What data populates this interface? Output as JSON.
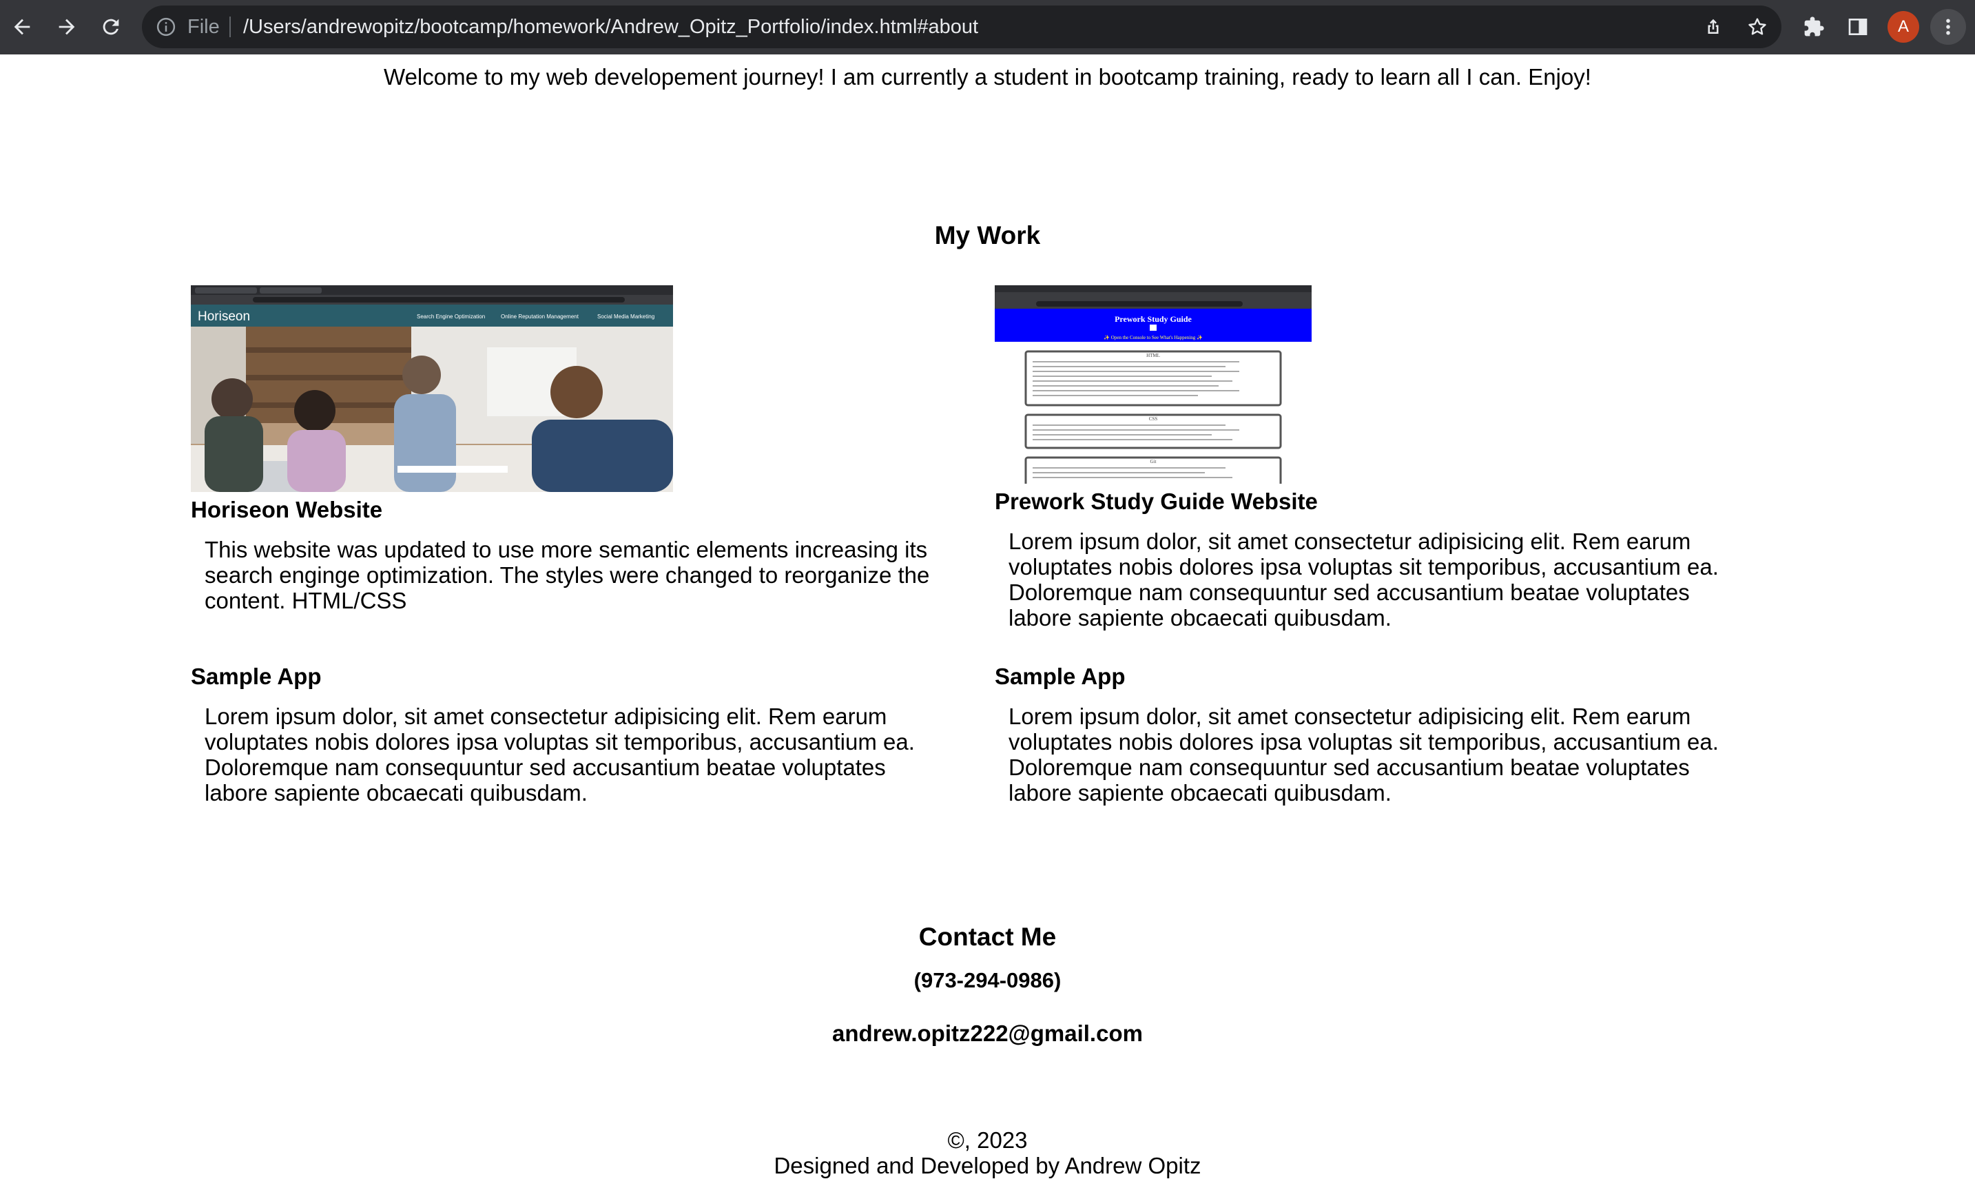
{
  "browser": {
    "scheme_label": "File",
    "url": "/Users/andrewopitz/bootcamp/homework/Andrew_Opitz_Portfolio/index.html#about",
    "profile_initial": "A",
    "icons": [
      "back-arrow-icon",
      "forward-arrow-icon",
      "reload-icon",
      "info-icon",
      "share-icon",
      "star-icon",
      "extensions-puzzle-icon",
      "side-panel-icon",
      "kebab-menu-icon"
    ],
    "colors": {
      "toolbar": "#35363a",
      "omnibox": "#202124",
      "avatar": "#c4411e"
    }
  },
  "page": {
    "welcome": "Welcome to my web developement journey! I am currently a student in bootcamp training, ready to learn all I can. Enjoy!",
    "work_heading": "My Work",
    "projects": [
      {
        "title": "Horiseon Website",
        "description": "This website was updated to use more semantic elements increasing its search enginge optimization. The styles were changed to reorganize the content. HTML/CSS",
        "image": {
          "brand": "Horiseon",
          "nav": [
            "Search Engine Optimization",
            "Online Reputation Management",
            "Social Media Marketing"
          ]
        }
      },
      {
        "title": "Prework Study Guide Website",
        "description": "Lorem ipsum dolor, sit amet consectetur adipisicing elit. Rem earum voluptates nobis dolores ipsa voluptas sit temporibus, accusantium ea. Doloremque nam consequuntur sed accusantium beatae voluptates labore sapiente obcaecati quibusdam.",
        "image": {
          "heading": "Prework Study Guide",
          "subheading": "✨ Open the Console to See What's Happening ✨",
          "sections": [
            "HTML",
            "CSS",
            "Git"
          ]
        }
      },
      {
        "title": "Sample App",
        "description": "Lorem ipsum dolor, sit amet consectetur adipisicing elit. Rem earum voluptates nobis dolores ipsa voluptas sit temporibus, accusantium ea. Doloremque nam consequuntur sed accusantium beatae voluptates labore sapiente obcaecati quibusdam."
      },
      {
        "title": "Sample App",
        "description": "Lorem ipsum dolor, sit amet consectetur adipisicing elit. Rem earum voluptates nobis dolores ipsa voluptas sit temporibus, accusantium ea. Doloremque nam consequuntur sed accusantium beatae voluptates labore sapiente obcaecati quibusdam."
      }
    ],
    "contact_heading": "Contact Me",
    "phone": "(973-294-0986)",
    "email": "andrew.opitz222@gmail.com",
    "copyright": "©, 2023",
    "credit": "Designed and Developed by Andrew Opitz"
  }
}
